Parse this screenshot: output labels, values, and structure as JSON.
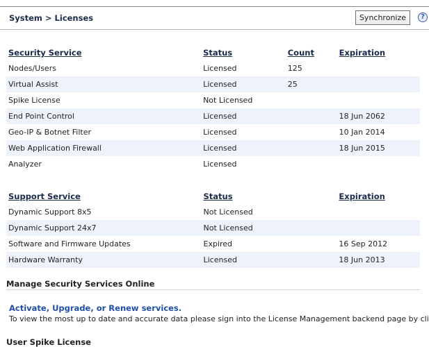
{
  "header": {
    "breadcrumb": "System > Licenses",
    "sync_label": "Synchronize",
    "help_glyph": "?"
  },
  "security": {
    "headers": [
      "Security Service",
      "Status",
      "Count",
      "Expiration"
    ],
    "rows": [
      [
        "Nodes/Users",
        "Licensed",
        "125",
        ""
      ],
      [
        "Virtual Assist",
        "Licensed",
        "25",
        ""
      ],
      [
        "Spike License",
        "Not Licensed",
        "",
        ""
      ],
      [
        "End Point Control",
        "Licensed",
        "",
        "18 Jun 2062"
      ],
      [
        "Geo-IP & Botnet Filter",
        "Licensed",
        "",
        "10 Jan 2014"
      ],
      [
        "Web Application Firewall",
        "Licensed",
        "",
        "18 Jun 2015"
      ],
      [
        "Analyzer",
        "Licensed",
        "",
        ""
      ]
    ]
  },
  "support": {
    "headers": [
      "Support Service",
      "Status",
      " ",
      "Expiration"
    ],
    "rows": [
      [
        "Dynamic Support 8x5",
        "Not Licensed",
        "",
        ""
      ],
      [
        "Dynamic Support 24x7",
        "Not Licensed",
        "",
        ""
      ],
      [
        "Software and Firmware Updates",
        "Expired",
        "",
        "16 Sep 2012"
      ],
      [
        "Hardware Warranty",
        "Licensed",
        "",
        "18 Jun 2013"
      ]
    ]
  },
  "manage": {
    "title": "Manage Security Services Online",
    "link_label": "Activate, Upgrade, or Renew services.",
    "info": "To view the most up to date and accurate data please sign into the License Management backend page by clicking the link abo"
  },
  "spike": {
    "title": "User Spike License"
  },
  "colors": {
    "link": "#1f4ea8",
    "row_alt": "#eef3fb",
    "heading": "#1a2a4a"
  }
}
